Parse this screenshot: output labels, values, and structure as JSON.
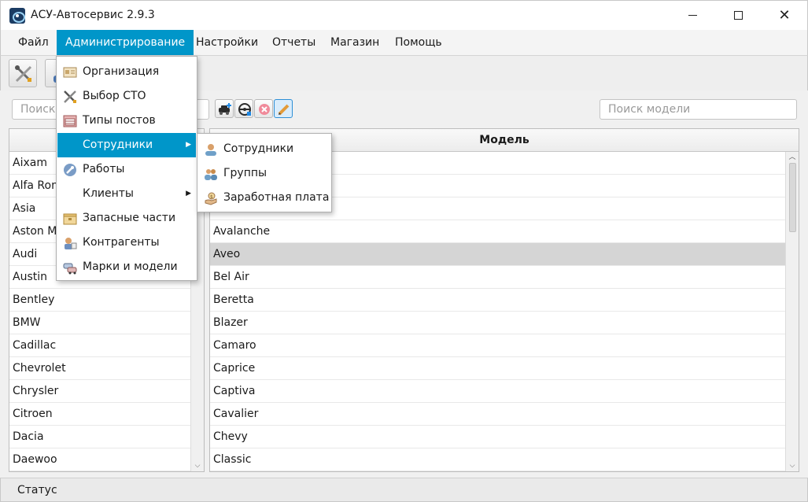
{
  "window": {
    "title": "АСУ-Автосервис 2.9.3",
    "minimize_glyph": "—",
    "maximize_glyph": "☐",
    "close_glyph": "✕"
  },
  "menubar": {
    "items": [
      {
        "label": "Файл"
      },
      {
        "label": "Администрирование"
      },
      {
        "label": "Настройки"
      },
      {
        "label": "Отчеты"
      },
      {
        "label": "Магазин"
      },
      {
        "label": "Помощь"
      }
    ],
    "active": "Администрирование"
  },
  "toolbar": {
    "buttons": [
      {
        "icon": "tools-icon"
      },
      {
        "icon": "worker-icon"
      }
    ]
  },
  "search": {
    "brand_placeholder": "Поиск",
    "model_placeholder": "Поиск модели"
  },
  "action_buttons": [
    {
      "icon": "add-car-icon"
    },
    {
      "icon": "steering-wheel-icon"
    },
    {
      "icon": "delete-icon"
    },
    {
      "icon": "edit-pencil-icon"
    }
  ],
  "brands_table": {
    "header": "",
    "rows": [
      "Aixam",
      "Alfa Romeo",
      "Asia",
      "Aston Martin",
      "Audi",
      "Austin",
      "Bentley",
      "BMW",
      "Cadillac",
      "Chevrolet",
      "Chrysler",
      "Citroen",
      "Dacia",
      "Daewoo"
    ]
  },
  "models_table": {
    "header": "Модель",
    "rows": [
      "",
      "",
      "",
      "Avalanche",
      "Aveo",
      "Bel Air",
      "Beretta",
      "Blazer",
      "Camaro",
      "Caprice",
      "Captiva",
      "Cavalier",
      "Chevy",
      "Classic"
    ],
    "selected": "Aveo"
  },
  "admin_menu": {
    "items": [
      {
        "label": "Организация",
        "icon": "organization-icon"
      },
      {
        "label": "Выбор СТО",
        "icon": "tools-icon"
      },
      {
        "label": "Типы постов",
        "icon": "garage-icon"
      },
      {
        "label": "Сотрудники",
        "icon": "",
        "submenu": true
      },
      {
        "label": "Работы",
        "icon": "wrench-icon"
      },
      {
        "label": "Клиенты",
        "icon": "",
        "submenu": true
      },
      {
        "label": "Запасные части",
        "icon": "parts-box-icon"
      },
      {
        "label": "Контрагенты",
        "icon": "contractor-icon"
      },
      {
        "label": "Марки и модели",
        "icon": "cars-icon"
      }
    ],
    "highlighted": "Сотрудники"
  },
  "employees_submenu": {
    "items": [
      {
        "label": "Сотрудники",
        "icon": "employee-icon"
      },
      {
        "label": "Группы",
        "icon": "group-icon"
      },
      {
        "label": "Заработная плата",
        "icon": "salary-icon"
      }
    ]
  },
  "statusbar": {
    "text": "Статус"
  },
  "colors": {
    "accent": "#0096c9",
    "selected_row": "#d5d5d5"
  }
}
